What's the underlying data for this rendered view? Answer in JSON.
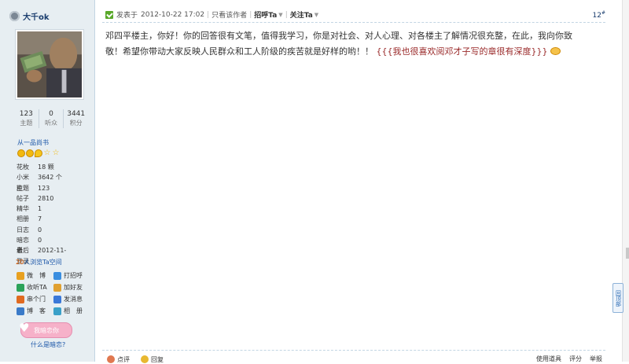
{
  "author": {
    "name": "大千ok",
    "stats": [
      {
        "value": "123",
        "label": "主题"
      },
      {
        "value": "0",
        "label": "听众"
      },
      {
        "value": "3441",
        "label": "积分"
      }
    ],
    "rank_title": "从一品尚书",
    "profile": [
      {
        "key": "花枚",
        "value": "18 颗"
      },
      {
        "key": "小米粒",
        "value": "3642 个"
      },
      {
        "key": "主题",
        "value": "123"
      },
      {
        "key": "帖子",
        "value": "2810"
      },
      {
        "key": "精华",
        "value": "1"
      },
      {
        "key": "相册",
        "value": "7"
      },
      {
        "key": "日志",
        "value": "0"
      },
      {
        "key": "暗恋者",
        "value": "0"
      },
      {
        "key": "最后登录",
        "value": "2012-11-"
      }
    ],
    "visitors": {
      "count": "20",
      "text": "人浏览Ta空间"
    },
    "actions": [
      {
        "label": "微　博",
        "color": "#e8a020"
      },
      {
        "label": "打招呼",
        "color": "#3a8ee0"
      },
      {
        "label": "收听TA",
        "color": "#2ca35a"
      },
      {
        "label": "加好友",
        "color": "#e0a030"
      },
      {
        "label": "串个门",
        "color": "#e06a20"
      },
      {
        "label": "发消息",
        "color": "#3a78d8"
      },
      {
        "label": "博　客",
        "color": "#3a7ac8"
      },
      {
        "label": "相　册",
        "color": "#3aa0c8"
      }
    ],
    "love_button": "我暗恋你",
    "what_is_crush": "什么是暗恋?"
  },
  "post": {
    "posted_prefix": "发表于",
    "posted_time": "2012-10-22 17:02",
    "only_author": "只看该作者",
    "greet": "招呼Ta",
    "follow": "关注Ta",
    "floor": "12",
    "floor_sup": "#",
    "body_text": "邓四平楼主，你好！你的回答很有文笔，值得我学习，你是对社会、对人心理、对各楼主了解情况很充整，在此，我向你致敬！希望你带动大家反映人民群众和工人阶级的疾苦就是好样的哟！！",
    "body_quote": "{{{我也很喜欢阅邓才子写的章很有深度}}}"
  },
  "bottom": {
    "left": [
      "点评",
      "回复"
    ],
    "right": [
      "使用道具",
      "评分",
      "举报"
    ]
  },
  "back_top": "回顶部",
  "colors": {
    "sidebar_bg": "#e7eef2",
    "link_blue": "#1b56a8",
    "quote_red": "#9a2a2a"
  }
}
